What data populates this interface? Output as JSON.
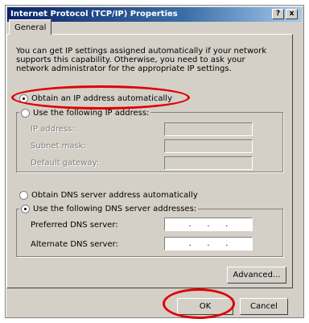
{
  "window": {
    "title": "Internet Protocol (TCP/IP) Properties",
    "help_label": "?",
    "close_label": "x"
  },
  "tabs": [
    {
      "label": "General"
    }
  ],
  "general": {
    "description": "You can get IP settings assigned automatically if your network supports this capability. Otherwise, you need to ask your network administrator for the appropriate IP settings.",
    "ip_auto_label": "Obtain an IP address automatically",
    "ip_manual_label": "Use the following IP address:",
    "ip_address_label": "IP address:",
    "subnet_label": "Subnet mask:",
    "gateway_label": "Default gateway:",
    "dns_auto_label": "Obtain DNS server address automatically",
    "dns_manual_label": "Use the following DNS server addresses:",
    "preferred_dns_label": "Preferred DNS server:",
    "alternate_dns_label": "Alternate DNS server:",
    "ip_dot": "."
  },
  "buttons": {
    "advanced": "Advanced...",
    "ok": "OK",
    "cancel": "Cancel"
  },
  "colors": {
    "annotation": "#e00000",
    "titlebar": "#0a246a"
  }
}
